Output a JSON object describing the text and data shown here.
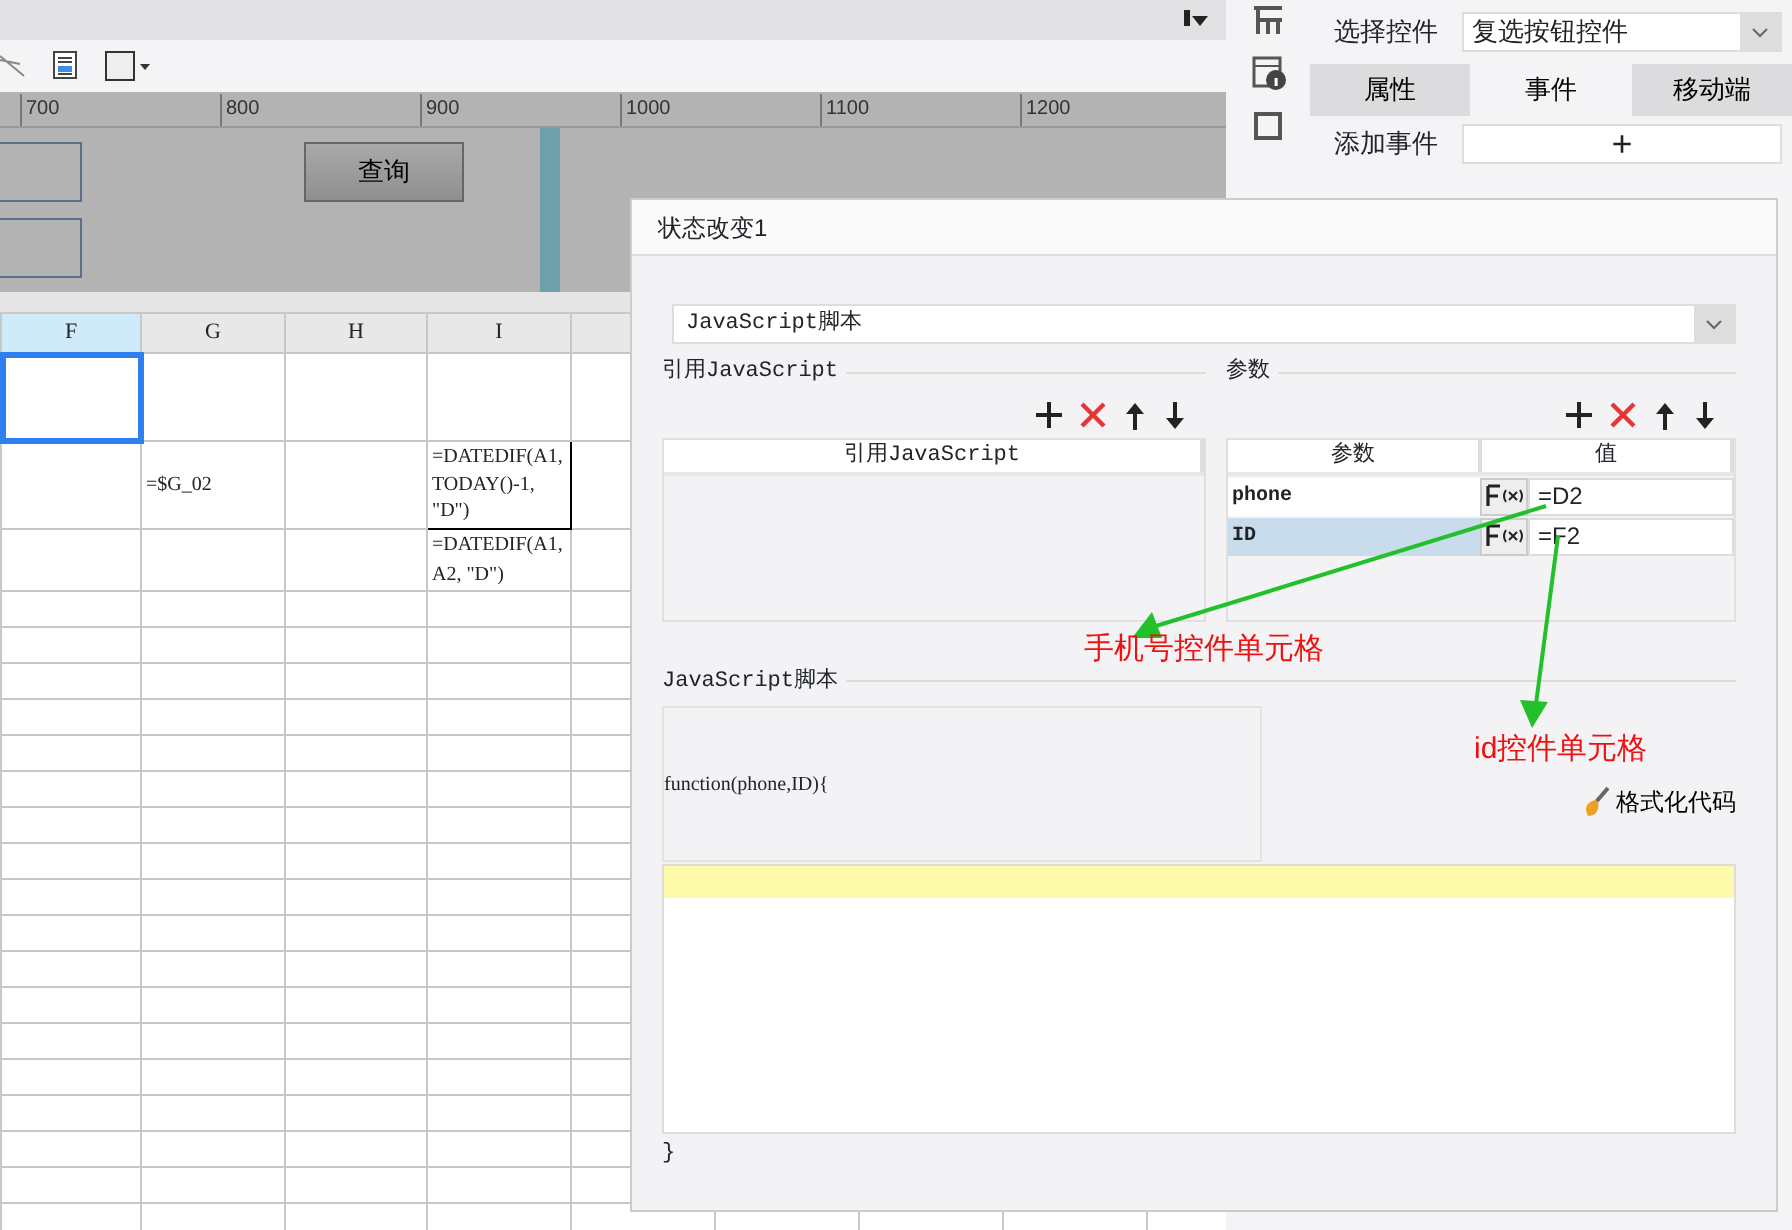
{
  "ruler": {
    "labels": [
      "700",
      "800",
      "900",
      "1000",
      "1100",
      "1200"
    ]
  },
  "canvas": {
    "button": "查询"
  },
  "sheet": {
    "columns": [
      {
        "label": "F",
        "selected": true
      },
      {
        "label": "G",
        "selected": false
      },
      {
        "label": "H",
        "selected": false
      },
      {
        "label": "I",
        "selected": false
      }
    ],
    "rows": [
      [
        "",
        "",
        "",
        ""
      ],
      [
        "",
        "=$G_02",
        "",
        "=DATEDIF(A1, TODAY()-1, \"D\")"
      ],
      [
        "",
        "",
        "",
        "=DATEDIF(A1, A2, \"D\")"
      ]
    ]
  },
  "right_panel": {
    "select_label": "选择控件",
    "select_value": "复选按钮控件",
    "tabs": [
      {
        "label": "属性",
        "selected": false
      },
      {
        "label": "事件",
        "selected": true
      },
      {
        "label": "移动端",
        "selected": false
      }
    ],
    "add_event_label": "添加事件",
    "add_event_button": "+"
  },
  "dialog": {
    "title": "状态改变1",
    "type_select": "JavaScript脚本",
    "ref_section": {
      "title": "引用JavaScript",
      "column": "引用JavaScript"
    },
    "param_section": {
      "title": "参数",
      "columns": [
        "参数",
        "值"
      ],
      "rows": [
        {
          "name": "phone",
          "value": "=D2",
          "selected": false
        },
        {
          "name": "ID",
          "value": "=F2",
          "selected": true
        }
      ]
    },
    "script_section": {
      "title": "JavaScript脚本",
      "header": "function(phone,ID){",
      "format_button": "格式化代码",
      "footer": "}"
    }
  },
  "annotations": [
    {
      "text": "手机号控件单元格"
    },
    {
      "text": "id控件单元格"
    }
  ]
}
